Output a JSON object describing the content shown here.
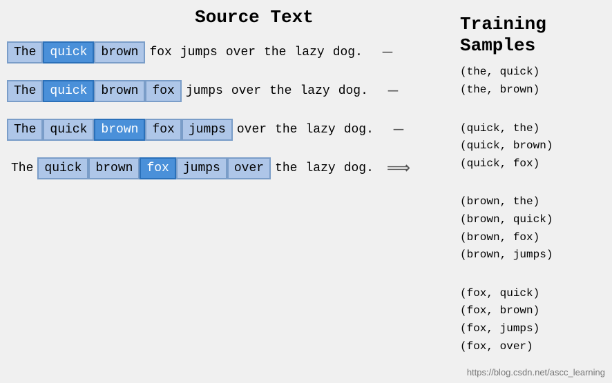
{
  "header": {
    "source_text_title": "Source Text",
    "training_title": "Training\nSamples"
  },
  "rows": [
    {
      "words": [
        {
          "text": "The",
          "type": "box-light"
        },
        {
          "text": "quick",
          "type": "box-blue"
        },
        {
          "text": "brown",
          "type": "box-light"
        },
        {
          "text": "fox",
          "type": "plain"
        },
        {
          "text": "jumps",
          "type": "plain"
        },
        {
          "text": "over",
          "type": "plain"
        },
        {
          "text": "the",
          "type": "plain"
        },
        {
          "text": "lazy",
          "type": "plain"
        },
        {
          "text": "dog.",
          "type": "plain"
        }
      ],
      "arrow": "—",
      "samples": [
        "(the, quick)",
        "(the, brown)"
      ]
    },
    {
      "words": [
        {
          "text": "The",
          "type": "box-light"
        },
        {
          "text": "quick",
          "type": "box-blue"
        },
        {
          "text": "brown",
          "type": "box-light"
        },
        {
          "text": "fox",
          "type": "box-light"
        },
        {
          "text": "jumps",
          "type": "plain"
        },
        {
          "text": "over",
          "type": "plain"
        },
        {
          "text": "the",
          "type": "plain"
        },
        {
          "text": "lazy",
          "type": "plain"
        },
        {
          "text": "dog.",
          "type": "plain"
        }
      ],
      "arrow": "—",
      "samples": [
        "(quick, the)",
        "(quick, brown)",
        "(quick, fox)"
      ]
    },
    {
      "words": [
        {
          "text": "The",
          "type": "box-light"
        },
        {
          "text": "quick",
          "type": "box-light"
        },
        {
          "text": "brown",
          "type": "box-blue"
        },
        {
          "text": "fox",
          "type": "box-light"
        },
        {
          "text": "jumps",
          "type": "box-light"
        },
        {
          "text": "over",
          "type": "plain"
        },
        {
          "text": "the",
          "type": "plain"
        },
        {
          "text": "lazy",
          "type": "plain"
        },
        {
          "text": "dog.",
          "type": "plain"
        }
      ],
      "arrow": "—",
      "samples": [
        "(brown, the)",
        "(brown, quick)",
        "(brown, fox)",
        "(brown, jumps)"
      ]
    },
    {
      "words": [
        {
          "text": "The",
          "type": "plain"
        },
        {
          "text": "quick",
          "type": "box-light"
        },
        {
          "text": "brown",
          "type": "box-light"
        },
        {
          "text": "fox",
          "type": "box-blue"
        },
        {
          "text": "jumps",
          "type": "box-light"
        },
        {
          "text": "over",
          "type": "box-light"
        },
        {
          "text": "the",
          "type": "plain"
        },
        {
          "text": "lazy",
          "type": "plain"
        },
        {
          "text": "dog.",
          "type": "plain"
        }
      ],
      "arrow": "⟹",
      "samples": [
        "(fox, quick)",
        "(fox, brown)",
        "(fox, jumps)",
        "(fox, over)"
      ]
    }
  ],
  "watermark": "https://blog.csdn.net/ascc_learning"
}
